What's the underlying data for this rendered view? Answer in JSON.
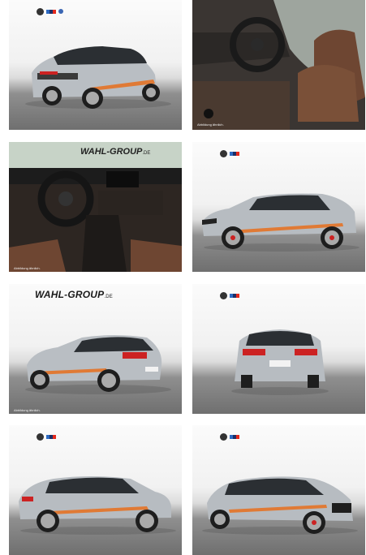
{
  "gallery": {
    "images": [
      {
        "id": "rear-left-3q",
        "alt": ""
      },
      {
        "id": "interior-front",
        "alt": ""
      },
      {
        "id": "dashboard",
        "alt": ""
      },
      {
        "id": "side-right",
        "alt": ""
      },
      {
        "id": "rear-left-3q-2",
        "alt": ""
      },
      {
        "id": "rear",
        "alt": ""
      },
      {
        "id": "side-left",
        "alt": ""
      },
      {
        "id": "front-left-3q",
        "alt": ""
      }
    ],
    "dealer_brand": "WAHL",
    "dealer_brand_suffix": "-GROUP",
    "dealer_brand_tld": ".DE",
    "disclaimer": "Abbildung ähnlich."
  },
  "colors": {
    "car_body": "#b7bcc1",
    "stripe": "#e07a35",
    "interior": "#6e4632"
  }
}
